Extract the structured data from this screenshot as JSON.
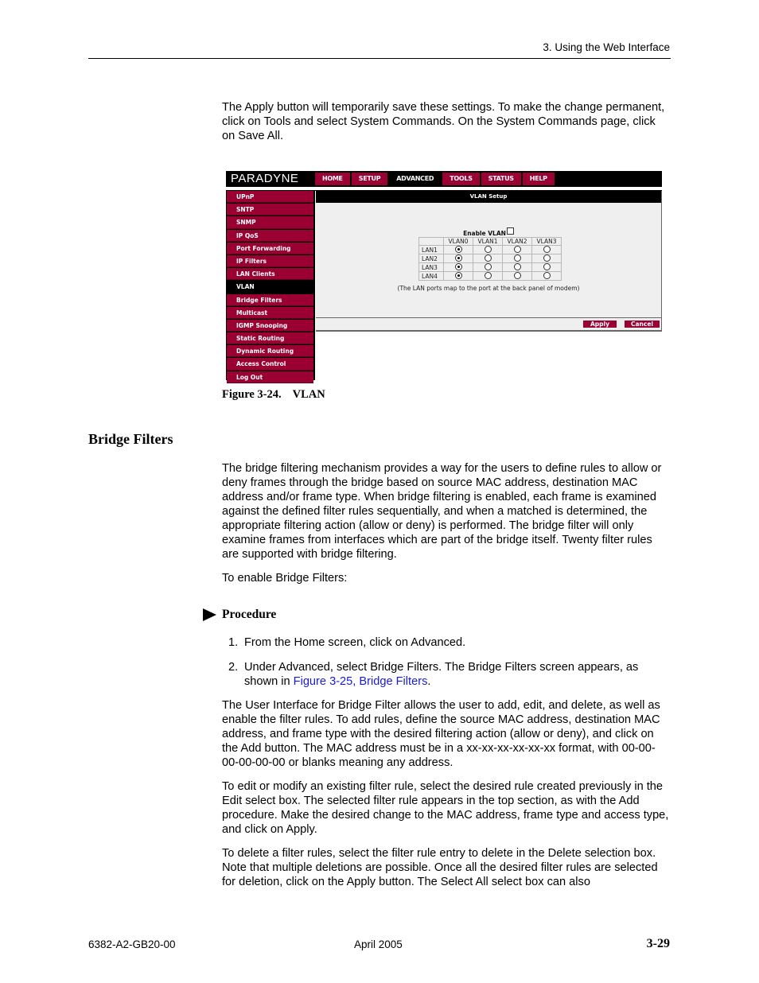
{
  "header": {
    "chapter": "3. Using the Web Interface"
  },
  "intro_paragraph": "The Apply button will temporarily save these settings. To make the change permanent, click on Tools and select System Commands. On the System Commands page, click on Save All.",
  "figure": {
    "screenshot": {
      "logo": "PARADYNE",
      "top_nav": [
        {
          "label": "HOME",
          "active": false
        },
        {
          "label": "SETUP",
          "active": false
        },
        {
          "label": "ADVANCED",
          "active": true
        },
        {
          "label": "TOOLS",
          "active": false
        },
        {
          "label": "STATUS",
          "active": false
        },
        {
          "label": "HELP",
          "active": false
        }
      ],
      "sidebar": [
        {
          "label": "UPnP",
          "active": false
        },
        {
          "label": "SNTP",
          "active": false
        },
        {
          "label": "SNMP",
          "active": false
        },
        {
          "label": "IP QoS",
          "active": false
        },
        {
          "label": "Port Forwarding",
          "active": false
        },
        {
          "label": "IP Filters",
          "active": false
        },
        {
          "label": "LAN Clients",
          "active": false
        },
        {
          "label": "VLAN",
          "active": true
        },
        {
          "label": "Bridge Filters",
          "active": false
        },
        {
          "label": "Multicast",
          "active": false
        },
        {
          "label": "IGMP Snooping",
          "active": false
        },
        {
          "label": "Static Routing",
          "active": false
        },
        {
          "label": "Dynamic Routing",
          "active": false
        },
        {
          "label": "Access Control",
          "active": false
        },
        {
          "label": "Log Out",
          "active": false
        }
      ],
      "content_title": "VLAN Setup",
      "enable_vlan_label": "Enable VLAN",
      "enable_vlan_checked": false,
      "vlan_table": {
        "columns": [
          "VLAN0",
          "VLAN1",
          "VLAN2",
          "VLAN3"
        ],
        "rows": [
          {
            "lan": "LAN1",
            "selected": "VLAN0"
          },
          {
            "lan": "LAN2",
            "selected": "VLAN0"
          },
          {
            "lan": "LAN3",
            "selected": "VLAN0"
          },
          {
            "lan": "LAN4",
            "selected": "VLAN0"
          }
        ]
      },
      "note": "(The LAN ports map to the port at the back panel of modem)",
      "buttons": {
        "apply": "Apply",
        "cancel": "Cancel"
      },
      "colors": {
        "accent": "#9b0033",
        "nav_bg": "#000000",
        "content_bg": "#efefef"
      }
    },
    "caption_number": "Figure 3-24.",
    "caption_title": "VLAN"
  },
  "section": {
    "title": "Bridge Filters",
    "paragraph1": "The bridge filtering mechanism provides a way for the users to define rules to allow or deny frames through the bridge based on source MAC address, destination MAC address and/or frame type. When bridge filtering is enabled, each frame is examined against the defined filter rules sequentially, and when a matched is determined, the appropriate filtering action (allow or deny) is performed. The bridge filter will only examine frames from interfaces which are part of the bridge itself. Twenty filter rules are supported with bridge filtering.",
    "paragraph2": "To enable Bridge Filters:",
    "procedure_label": "Procedure",
    "steps": [
      {
        "n": "1.",
        "text": "From the Home screen, click on Advanced."
      },
      {
        "n": "2.",
        "text": "Under Advanced, select Bridge Filters.  The Bridge Filters screen appears, as shown in ",
        "link": "Figure 3-25, Bridge Filters",
        "after": "."
      }
    ],
    "paragraph3": "The User Interface for Bridge Filter allows the user to add, edit, and delete, as well as enable the filter rules. To add rules, define the source MAC address, destination MAC address, and frame type with the desired filtering action (allow or deny), and click on the Add button. The MAC address must be in a xx-xx-xx-xx-xx-xx format, with 00-00-00-00-00-00 or blanks meaning any address.",
    "paragraph4": "To edit or modify an existing filter rule, select the desired rule created previously in the Edit select box. The selected filter rule appears in the top section, as with the Add procedure. Make the desired change to the MAC address, frame type and access type, and click on Apply.",
    "paragraph5": "To delete a filter rules, select the filter rule entry to delete in the Delete selection box. Note that multiple deletions are possible. Once all the desired filter rules are selected for deletion, click on the Apply button. The Select All select box can also"
  },
  "footer": {
    "doc_number": "6382-A2-GB20-00",
    "date": "April 2005",
    "page": "3-29"
  }
}
